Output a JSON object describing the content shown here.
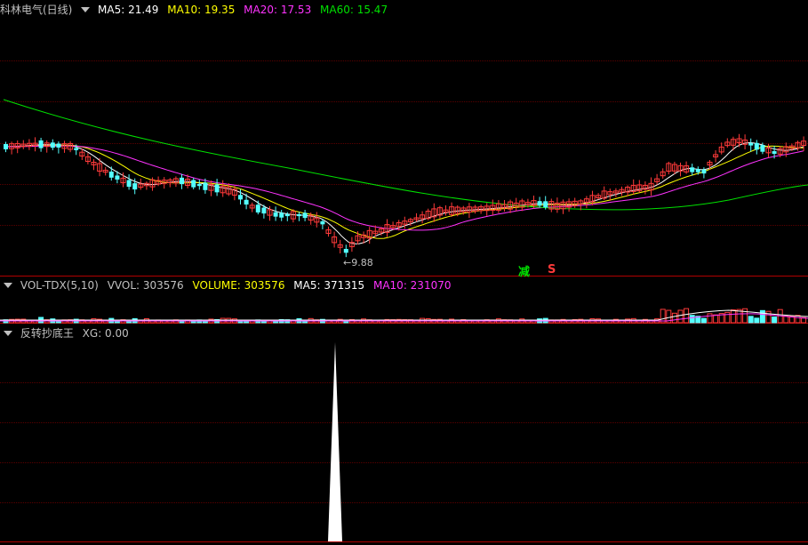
{
  "main_header": {
    "stock_name": "科林电气(日线)",
    "ma5": "MA5: 21.49",
    "ma10": "MA10: 19.35",
    "ma20": "MA20: 17.53",
    "ma60": "MA60: 15.47"
  },
  "low_label": "9.88",
  "signals": {
    "reduce": "减",
    "sell": "S"
  },
  "vol_header": {
    "indicator": "VOL-TDX(5,10)",
    "vvol": "VVOL: 303576",
    "volume": "VOLUME: 303576",
    "ma5": "MA5: 371315",
    "ma10": "MA10: 231070"
  },
  "xg_header": {
    "indicator": "反转抄底王",
    "xg": "XG: 0.00"
  },
  "colors": {
    "up": "#ff3a3a",
    "down": "#54ffff",
    "ma5": "#ffffff",
    "ma10": "#ffff00",
    "ma20": "#ff33ff",
    "ma60": "#00e000",
    "grid": "#5a0000",
    "border": "#b00000"
  },
  "chart_data": {
    "type": "candlestick",
    "price_range": [
      8.5,
      24.5
    ],
    "low_marker": 9.88,
    "ma_lines": [
      "MA5",
      "MA10",
      "MA20",
      "MA60"
    ],
    "xg_values": [
      0,
      1,
      0
    ]
  }
}
